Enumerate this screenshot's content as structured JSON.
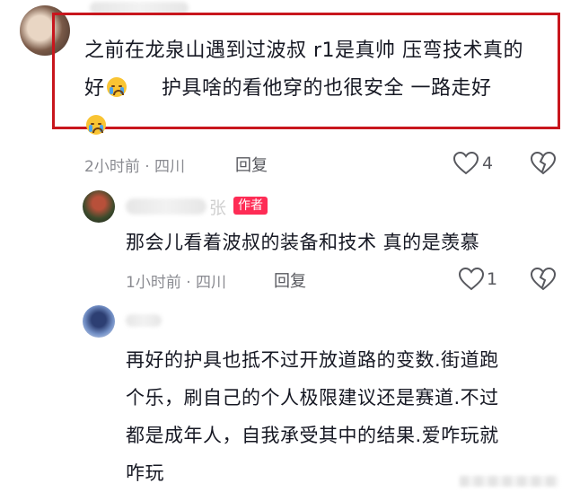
{
  "comment1": {
    "text_line1": "之前在龙泉山遇到过波叔 r1是真帅 压弯技术真的",
    "text_line2a": "好",
    "text_line2b": "护具啥的看他穿的也很安全  一路走好",
    "emoji_name": "crying-emoji",
    "meta": "2小时前 · 四川",
    "reply_label": "回复",
    "like_count": "4"
  },
  "reply1": {
    "name_tail": "张",
    "author_badge": "作者",
    "text": "那会儿看着波叔的装备和技术 真的是羡慕",
    "meta": "1小时前 · 四川",
    "reply_label": "回复",
    "like_count": "1"
  },
  "reply2": {
    "text_lines": [
      "再好的护具也抵不过开放道路的变数.街道跑",
      "个乐，刷自己的个人极限建议还是赛道.不过",
      "都是成年人，自我承受其中的结果.爱咋玩就",
      "咋玩"
    ]
  },
  "colors": {
    "highlight": "#c8161d",
    "badge": "#fe2c55",
    "meta": "#8a8b91"
  }
}
